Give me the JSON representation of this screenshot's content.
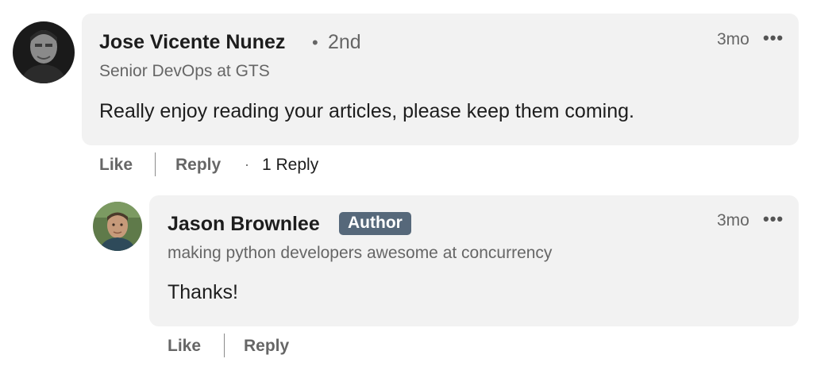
{
  "comment": {
    "author_name": "Jose Vicente Nunez",
    "connection_degree": "2nd",
    "headline": "Senior DevOps at GTS",
    "text": "Really enjoy reading your articles, please keep them coming.",
    "time_ago": "3mo",
    "more_icon": "more-horizontal-icon",
    "actions": {
      "like": "Like",
      "reply": "Reply",
      "reply_count": "1 Reply"
    }
  },
  "reply": {
    "author_name": "Jason Brownlee",
    "badge": "Author",
    "headline": "making python developers awesome at concurrency",
    "text": "Thanks!",
    "time_ago": "3mo",
    "more_icon": "more-horizontal-icon",
    "actions": {
      "like": "Like",
      "reply": "Reply"
    }
  },
  "colors": {
    "bubble_bg": "#f2f2f2",
    "badge_bg": "#56687a",
    "secondary_text": "#666666",
    "primary_text": "#1d1d1d"
  }
}
